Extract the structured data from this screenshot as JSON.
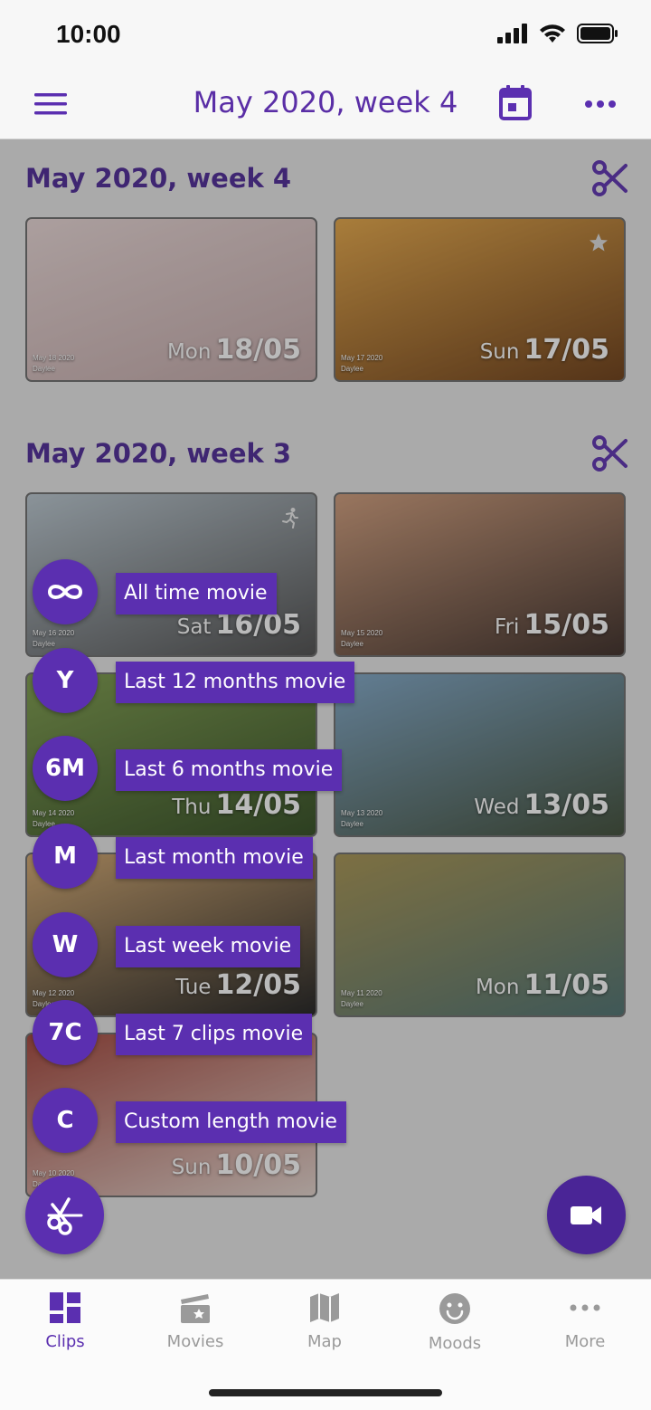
{
  "status_bar": {
    "time": "10:00"
  },
  "header": {
    "title": "May 2020, week 4"
  },
  "sections": [
    {
      "title": "May 2020, week 4",
      "clips": [
        {
          "dow": "Mon",
          "date": "18/05",
          "meta_date": "May 18 2020",
          "meta_app": "Daylee",
          "icon": "calendar-icon",
          "colors": [
            "#e9d7d6",
            "#c3a8a8"
          ]
        },
        {
          "dow": "Sun",
          "date": "17/05",
          "meta_date": "May 17 2020",
          "meta_app": "Daylee",
          "icon": "star-icon",
          "colors": [
            "#e5a544",
            "#6a3a12"
          ]
        }
      ]
    },
    {
      "title": "May 2020, week 3",
      "clips": [
        {
          "dow": "Sat",
          "date": "16/05",
          "meta_date": "May 16 2020",
          "meta_app": "Daylee",
          "icon": "running-person-icon",
          "colors": [
            "#b9c6cf",
            "#4b4b4b"
          ]
        },
        {
          "dow": "Fri",
          "date": "15/05",
          "meta_date": "May 15 2020",
          "meta_app": "Daylee",
          "icon": "",
          "colors": [
            "#cf9b79",
            "#3a2a24"
          ]
        },
        {
          "dow": "Thu",
          "date": "14/05",
          "meta_date": "May 14 2020",
          "meta_app": "Daylee",
          "icon": "",
          "colors": [
            "#7c9c4a",
            "#2f4a1e"
          ]
        },
        {
          "dow": "Wed",
          "date": "13/05",
          "meta_date": "May 13 2020",
          "meta_app": "Daylee",
          "icon": "",
          "colors": [
            "#7ea6c6",
            "#3c4a35"
          ]
        },
        {
          "dow": "Tue",
          "date": "12/05",
          "meta_date": "May 12 2020",
          "meta_app": "Daylee",
          "icon": "",
          "colors": [
            "#d4a86f",
            "#1c1c1c"
          ]
        },
        {
          "dow": "Mon",
          "date": "11/05",
          "meta_date": "May 11 2020",
          "meta_app": "Daylee",
          "icon": "",
          "colors": [
            "#a5924f",
            "#4b6f6e"
          ]
        },
        {
          "dow": "Sun",
          "date": "10/05",
          "meta_date": "May 10 2020",
          "meta_app": "Daylee",
          "icon": "",
          "colors": [
            "#a24237",
            "#e3d3cc"
          ]
        }
      ]
    }
  ],
  "fab_menu": [
    {
      "badge": "",
      "icon": "infinity-icon",
      "label": "All time movie"
    },
    {
      "badge": "Y",
      "label": "Last 12 months movie"
    },
    {
      "badge": "6M",
      "label": "Last 6 months movie"
    },
    {
      "badge": "M",
      "label": "Last month movie"
    },
    {
      "badge": "W",
      "label": "Last week movie"
    },
    {
      "badge": "7C",
      "label": "Last 7 clips movie"
    },
    {
      "badge": "C",
      "label": "Custom length movie"
    }
  ],
  "tabs": [
    {
      "label": "Clips",
      "active": true
    },
    {
      "label": "Movies",
      "active": false
    },
    {
      "label": "Map",
      "active": false
    },
    {
      "label": "Moods",
      "active": false
    },
    {
      "label": "More",
      "active": false
    }
  ],
  "colors": {
    "accent": "#5b2fb0",
    "accent_dark": "#4a2596",
    "inactive": "#9a9a9a"
  }
}
